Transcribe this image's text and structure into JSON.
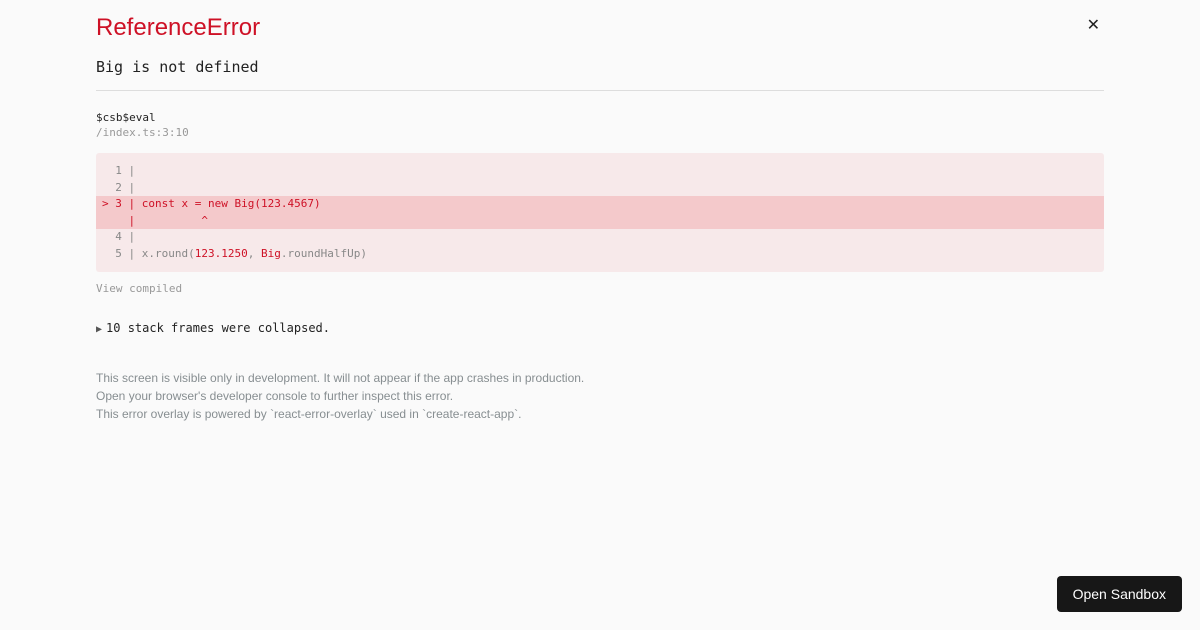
{
  "error": {
    "type": "ReferenceError",
    "message": "Big is not defined"
  },
  "frame": {
    "eval": "$csb$eval",
    "file": "/index.ts:3:10"
  },
  "code": {
    "l1_gutter": "  1 | ",
    "l1_body": "",
    "l2_gutter": "  2 | ",
    "l2_body": "",
    "l3_gutter": "> 3 | ",
    "l3_const": "const",
    "l3_mid": " x = ",
    "l3_new": "new",
    "l3_sp": " ",
    "l3_big": "Big",
    "l3_open": "(",
    "l3_num": "123.4567",
    "l3_close": ")",
    "caret_gutter": "    | ",
    "caret_body": "         ^",
    "l4_gutter": "  4 | ",
    "l4_body": "",
    "l5_gutter": "  5 | ",
    "l5_a": "x.round(",
    "l5_num": "123.1250",
    "l5_comma": ", ",
    "l5_big": "Big",
    "l5_b": ".roundHalfUp)"
  },
  "links": {
    "view_compiled": "View compiled",
    "collapsed": "10 stack frames were collapsed."
  },
  "footer": {
    "l1": "This screen is visible only in development. It will not appear if the app crashes in production.",
    "l2": "Open your browser's developer console to further inspect this error.",
    "l3": "This error overlay is powered by `react-error-overlay` used in `create-react-app`."
  },
  "buttons": {
    "open_sandbox": "Open Sandbox"
  }
}
